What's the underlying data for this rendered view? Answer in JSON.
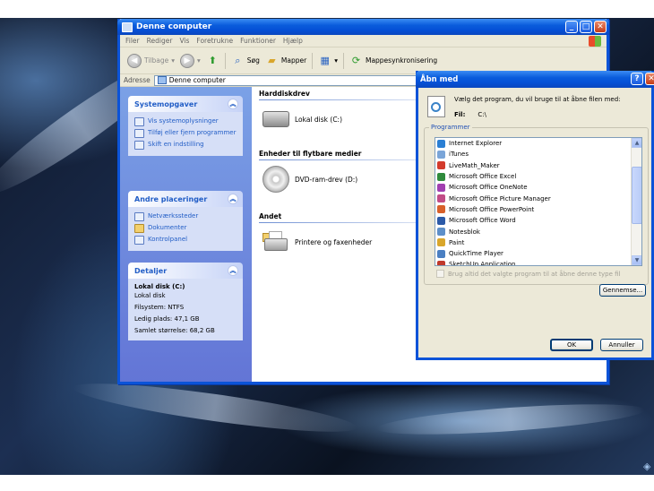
{
  "explorer": {
    "title": "Denne computer",
    "menu": [
      "Filer",
      "Rediger",
      "Vis",
      "Foretrukne",
      "Funktioner",
      "Hjælp"
    ],
    "toolbar": {
      "back": "Tilbage",
      "search": "Søg",
      "folders": "Mapper",
      "sync": "Mappesynkronisering"
    },
    "address": {
      "label": "Adresse",
      "value": "Denne computer"
    },
    "sidebar": {
      "system_tasks": {
        "title": "Systemopgaver",
        "items": [
          "Vis systemoplysninger",
          "Tilføj eller fjern programmer",
          "Skift en indstilling"
        ]
      },
      "other_places": {
        "title": "Andre placeringer",
        "items": [
          "Netværkssteder",
          "Dokumenter",
          "Kontrolpanel"
        ]
      },
      "details": {
        "title": "Detaljer",
        "name": "Lokal disk (C:)",
        "type": "Lokal disk",
        "filesystem": "Filsystem: NTFS",
        "free": "Ledig plads: 47,1 GB",
        "total": "Samlet størrelse: 68,2 GB"
      }
    },
    "groups": {
      "hdd": {
        "title": "Harddiskdrev",
        "items": [
          "Lokal disk (C:)"
        ]
      },
      "removable": {
        "title": "Enheder til flytbare medier",
        "items": [
          "DVD-ram-drev (D:)"
        ]
      },
      "other": {
        "title": "Andet",
        "items": [
          "Printere og faxenheder"
        ]
      }
    }
  },
  "dialog": {
    "title": "Åbn med",
    "prompt": "Vælg det program, du vil bruge til at åbne filen med:",
    "file_label": "Fil:",
    "file_value": "C:\\",
    "programs_label": "Programmer",
    "programs": [
      {
        "name": "Internet Explorer",
        "color": "#2a7fd4"
      },
      {
        "name": "iTunes",
        "color": "#7aa5d8"
      },
      {
        "name": "LiveMath_Maker",
        "color": "#d33b2c"
      },
      {
        "name": "Microsoft Office Excel",
        "color": "#2f8a3c"
      },
      {
        "name": "Microsoft Office OneNote",
        "color": "#a13fb0"
      },
      {
        "name": "Microsoft Office Picture Manager",
        "color": "#c14c86"
      },
      {
        "name": "Microsoft Office PowerPoint",
        "color": "#d8602a"
      },
      {
        "name": "Microsoft Office Word",
        "color": "#2b5aa8"
      },
      {
        "name": "Notesblok",
        "color": "#5d8fc9"
      },
      {
        "name": "Paint",
        "color": "#d9a62b"
      },
      {
        "name": "QuickTime Player",
        "color": "#4a7fc2"
      },
      {
        "name": "SketchUp Application",
        "color": "#c0392b"
      }
    ],
    "always_use": "Brug altid det valgte program til at åbne denne type fil",
    "browse": "Gennemse...",
    "ok": "OK",
    "cancel": "Annuller"
  }
}
